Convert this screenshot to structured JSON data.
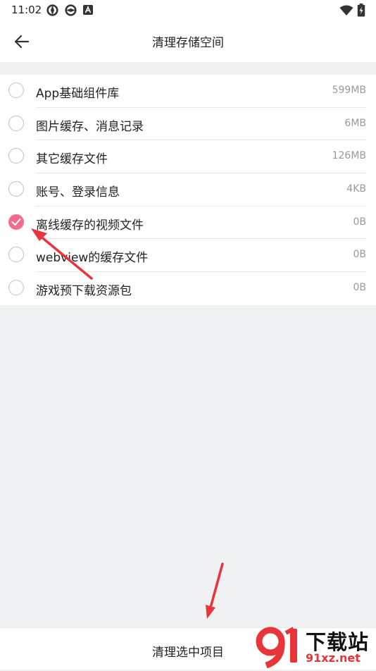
{
  "status_bar": {
    "time": "11:02"
  },
  "header": {
    "title": "清理存储空间"
  },
  "items": [
    {
      "label": "App基础组件库",
      "size": "599MB",
      "checked": false
    },
    {
      "label": "图片缓存、消息记录",
      "size": "6MB",
      "checked": false
    },
    {
      "label": "其它缓存文件",
      "size": "126MB",
      "checked": false
    },
    {
      "label": "账号、登录信息",
      "size": "4KB",
      "checked": false
    },
    {
      "label": "离线缓存的视频文件",
      "size": "0B",
      "checked": true
    },
    {
      "label": "webview的缓存文件",
      "size": "0B",
      "checked": false
    },
    {
      "label": "游戏预下载资源包",
      "size": "0B",
      "checked": false
    }
  ],
  "bottom": {
    "action_label": "清理选中项目"
  },
  "watermark": {
    "title": "下载站",
    "url": "91xz.net"
  },
  "colors": {
    "accent": "#f46b8f",
    "annotation_arrow": "#e8353a",
    "background": "#f0f1f3"
  }
}
